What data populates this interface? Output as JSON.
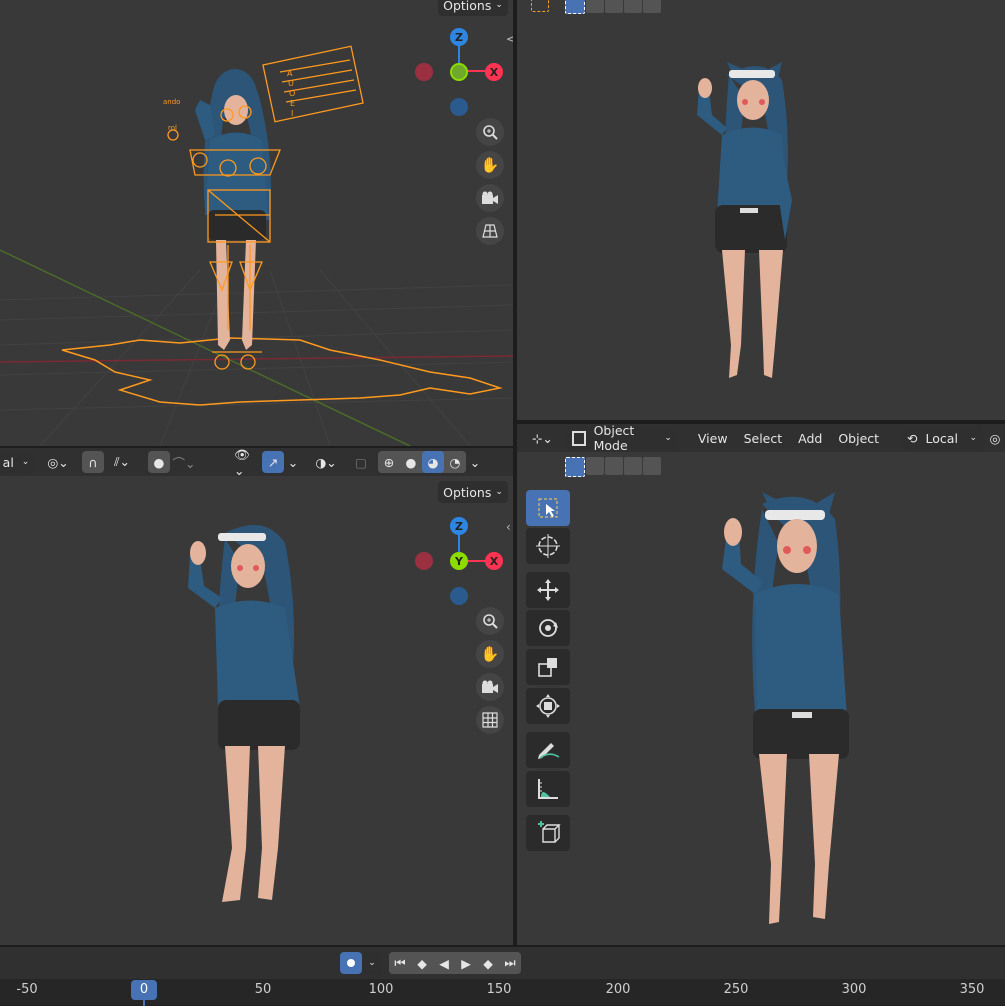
{
  "top_left": {
    "options_label": "Options",
    "gizmo": {
      "z": "Z",
      "x": "X"
    },
    "expand_arrow": "<>",
    "floating_label_1": "ando",
    "floating_label_2": "rol",
    "control_board_letters": [
      "A",
      "U",
      "O",
      "E",
      "I"
    ]
  },
  "top_right": {
    "chevron": "‹"
  },
  "bottom_left": {
    "options_label": "Options",
    "header_left_text": "al",
    "gizmo": {
      "z": "Z",
      "y": "Y",
      "x": "X"
    }
  },
  "bottom_right": {
    "mode_label": "Object Mode",
    "menus": [
      "View",
      "Select",
      "Add",
      "Object"
    ],
    "transform_orientation": "Local"
  },
  "timeline": {
    "current_frame": "0",
    "ticks": [
      "-50",
      "0",
      "50",
      "100",
      "150",
      "200",
      "250",
      "300",
      "350"
    ]
  },
  "colors": {
    "accent_blue": "#4772b3",
    "axis_x": "#ff3352",
    "axis_y": "#8bdc00",
    "axis_z": "#2d86e2",
    "rig_orange": "#ff9a1e"
  }
}
